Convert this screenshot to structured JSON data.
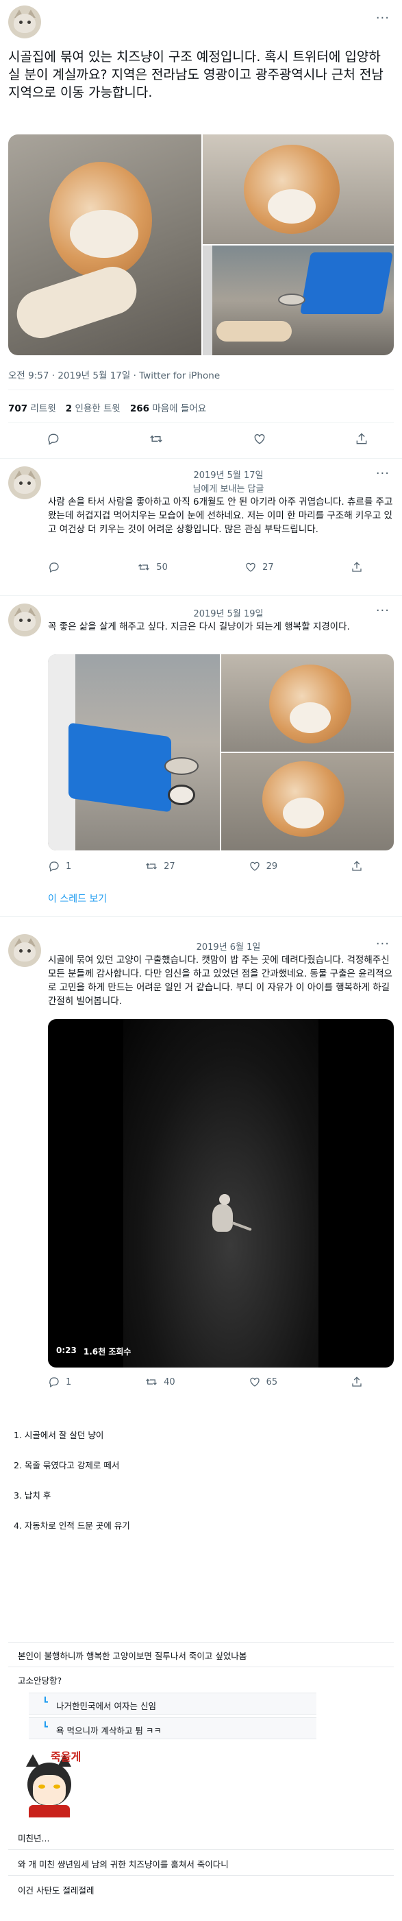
{
  "main_tweet": {
    "text": "시골집에 묶여 있는 치즈냥이 구조 예정입니다. 혹시 트위터에 입양하실 분이 계실까요? 지역은 전라남도 영광이고 광주광역시나 근처 전남 지역으로 이동 가능합니다.",
    "meta": "오전 9:57 · 2019년 5월 17일 · Twitter for iPhone",
    "retweets_count": "707",
    "retweets_label": "리트윗",
    "quotes_count": "2",
    "quotes_label": "인용한 트윗",
    "likes_count": "266",
    "likes_label": "마음에 들어요"
  },
  "reply1": {
    "date": "2019년 5월 17일",
    "subtitle": "님에게 보내는 답글",
    "text": "사람 손을 타서 사람을 좋아하고 아직 6개월도 안 된 아기라 아주 귀엽습니다. 츄르를 주고 왔는데 허겁지겁 먹어치우는 모습이 눈에 선하네요. 저는 이미 한 마리를 구조해 키우고 있고 여건상 더 키우는 것이 어려운 상황입니다. 많은 관심 부탁드립니다.",
    "retweets": "50",
    "likes": "27"
  },
  "reply2": {
    "date": "2019년 5월 19일",
    "text": "꼭 좋은 삶을 살게 해주고 싶다. 지금은 다시 길냥이가 되는게 행복할 지경이다.",
    "replies": "1",
    "retweets": "27",
    "likes": "29",
    "thread_link": "이 스레드 보기"
  },
  "reply3": {
    "date": "2019년 6월 1일",
    "text": "시골에 묶여 있던 고양이 구출했습니다. 캣맘이 밥 주는 곳에 데려다줬습니다. 걱정해주신 모든 분들께 감사합니다. 다만 임신을 하고 있었던 점을 간과했네요. 동물 구출은 윤리적으로 고민을 하게 만드는 어려운 일인 거 같습니다. 부디 이 자유가 이 아이를 행복하게 하길 간절히 빌어봅니다.",
    "video_time": "0:23",
    "video_views": "1.6천 조회수",
    "replies": "1",
    "retweets": "40",
    "likes": "65"
  },
  "summary_list": [
    "1. 시골에서 잘 살던 냥이",
    "2. 목줄 묶였다고 강제로 떼서",
    "3. 납치 후",
    "4. 자동차로 인적 드문 곳에 유기"
  ],
  "comments": {
    "c1": "본인이 불행하니까 행복한 고양이보면 질투나서 죽이고 싶었나봄",
    "c2": "고소안당항?",
    "r1": "나거한민국에서 여자는 신임",
    "r2": "욕 먹으니까 계삭하고 튐 ㅋㅋ",
    "sticker_text": "죽을게",
    "c3": "미친년...",
    "c4": "와 개 미친 썅년임세 남의 귀한 치즈냥이를 훔쳐서 죽이다니",
    "c5": "이건 사탄도 절레절레"
  },
  "colors": {
    "accent": "#1d9bf0",
    "muted": "#536471"
  }
}
